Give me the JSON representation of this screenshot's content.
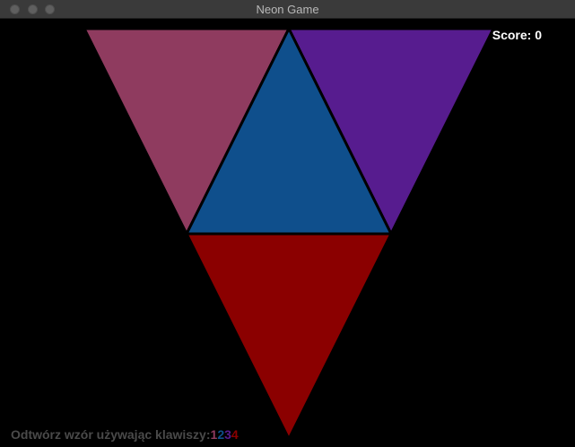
{
  "window": {
    "title": "Neon Game"
  },
  "hud": {
    "score_label": "Score:",
    "score_value": "0"
  },
  "instruction": {
    "text": "Odtwórz wzór używając klawiszy:",
    "keys": [
      {
        "label": "1",
        "color": "#8f3b5f"
      },
      {
        "label": "2",
        "color": "#0f4f8c"
      },
      {
        "label": "3",
        "color": "#571c8f"
      },
      {
        "label": "4",
        "color": "#8b0000"
      }
    ]
  },
  "tiles": [
    {
      "name": "tile-pink",
      "color": "#8f3b5f"
    },
    {
      "name": "tile-blue",
      "color": "#0f4f8c"
    },
    {
      "name": "tile-purple",
      "color": "#571c8f"
    },
    {
      "name": "tile-red",
      "color": "#8b0000"
    }
  ]
}
